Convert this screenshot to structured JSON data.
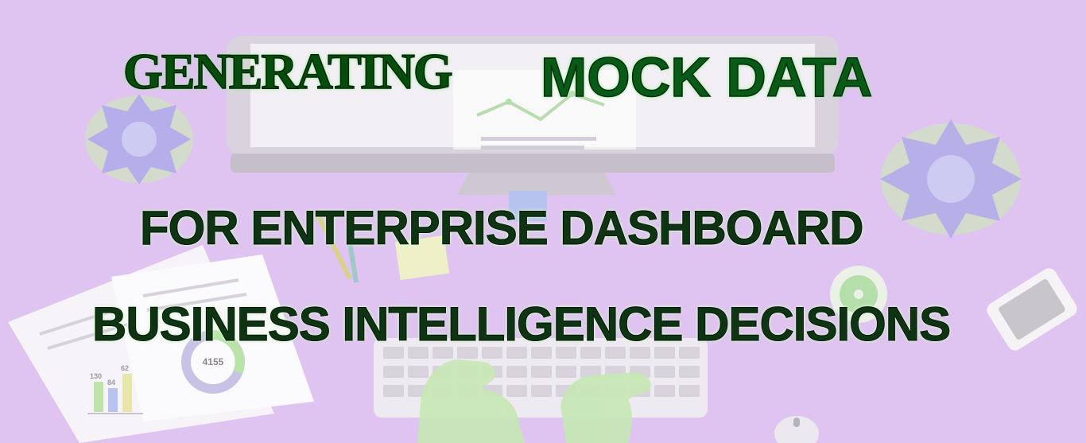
{
  "banner": {
    "title_part1": "GENERATING",
    "title_part2": "MOCK DATA",
    "subtitle_line1": "FOR ENTERPRISE DASHBOARD",
    "subtitle_line2": "BUSINESS INTELLIGENCE DECISIONS"
  },
  "illustration": {
    "donut_center_value": "4155",
    "bar_labels": [
      "130",
      "84",
      "62"
    ]
  },
  "colors": {
    "background": "#dfc3f0",
    "title_green": "#064d0c",
    "subtitle_dark": "#0f3413"
  }
}
